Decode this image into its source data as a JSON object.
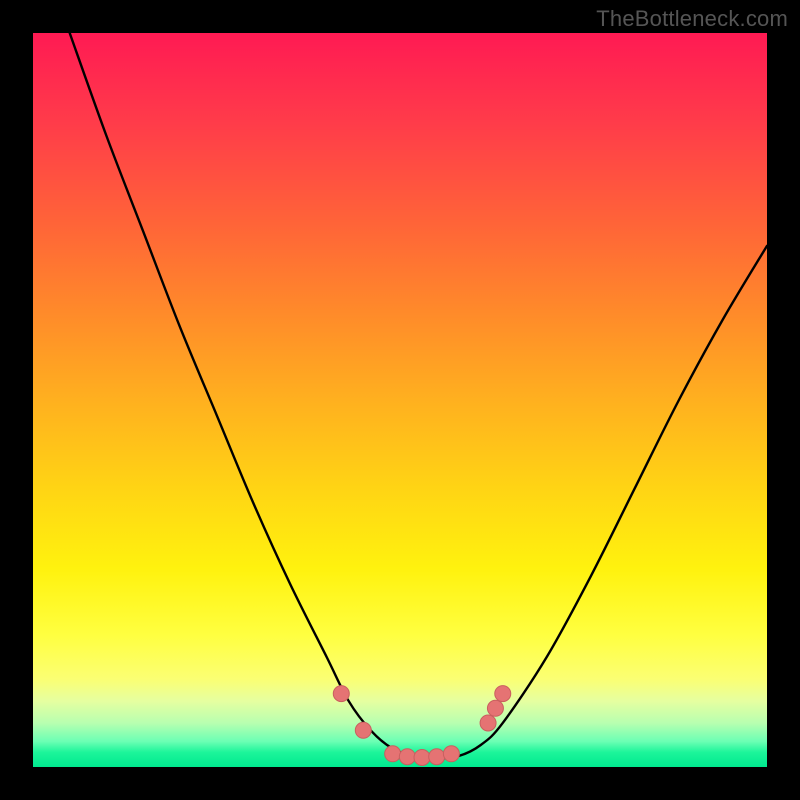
{
  "watermark": "TheBottleneck.com",
  "chart_data": {
    "type": "line",
    "title": "",
    "xlabel": "",
    "ylabel": "",
    "xlim": [
      0,
      100
    ],
    "ylim": [
      0,
      100
    ],
    "grid": false,
    "legend": false,
    "series": [
      {
        "name": "bottleneck-curve",
        "x": [
          5,
          10,
          15,
          20,
          25,
          30,
          35,
          40,
          43,
          46,
          49,
          52,
          55,
          58,
          61,
          64,
          70,
          76,
          82,
          88,
          94,
          100
        ],
        "y": [
          100,
          86,
          73,
          60,
          48,
          36,
          25,
          15,
          9,
          5,
          2.5,
          1.5,
          1.2,
          1.5,
          3,
          6,
          15,
          26,
          38,
          50,
          61,
          71
        ]
      }
    ],
    "markers": [
      {
        "name": "marker-left-1",
        "x": 42,
        "y": 10
      },
      {
        "name": "marker-left-2",
        "x": 45,
        "y": 5
      },
      {
        "name": "marker-flat-1",
        "x": 49,
        "y": 1.8
      },
      {
        "name": "marker-flat-2",
        "x": 51,
        "y": 1.4
      },
      {
        "name": "marker-flat-3",
        "x": 53,
        "y": 1.3
      },
      {
        "name": "marker-flat-4",
        "x": 55,
        "y": 1.4
      },
      {
        "name": "marker-flat-5",
        "x": 57,
        "y": 1.8
      },
      {
        "name": "marker-right-1",
        "x": 62,
        "y": 6
      },
      {
        "name": "marker-right-2",
        "x": 63,
        "y": 8
      },
      {
        "name": "marker-right-3",
        "x": 64,
        "y": 10
      }
    ],
    "colors": {
      "curve": "#000000",
      "marker_fill": "#e57373",
      "marker_stroke": "#c95f5f",
      "gradient_top": "#ff1a53",
      "gradient_bottom": "#00e98f"
    }
  }
}
